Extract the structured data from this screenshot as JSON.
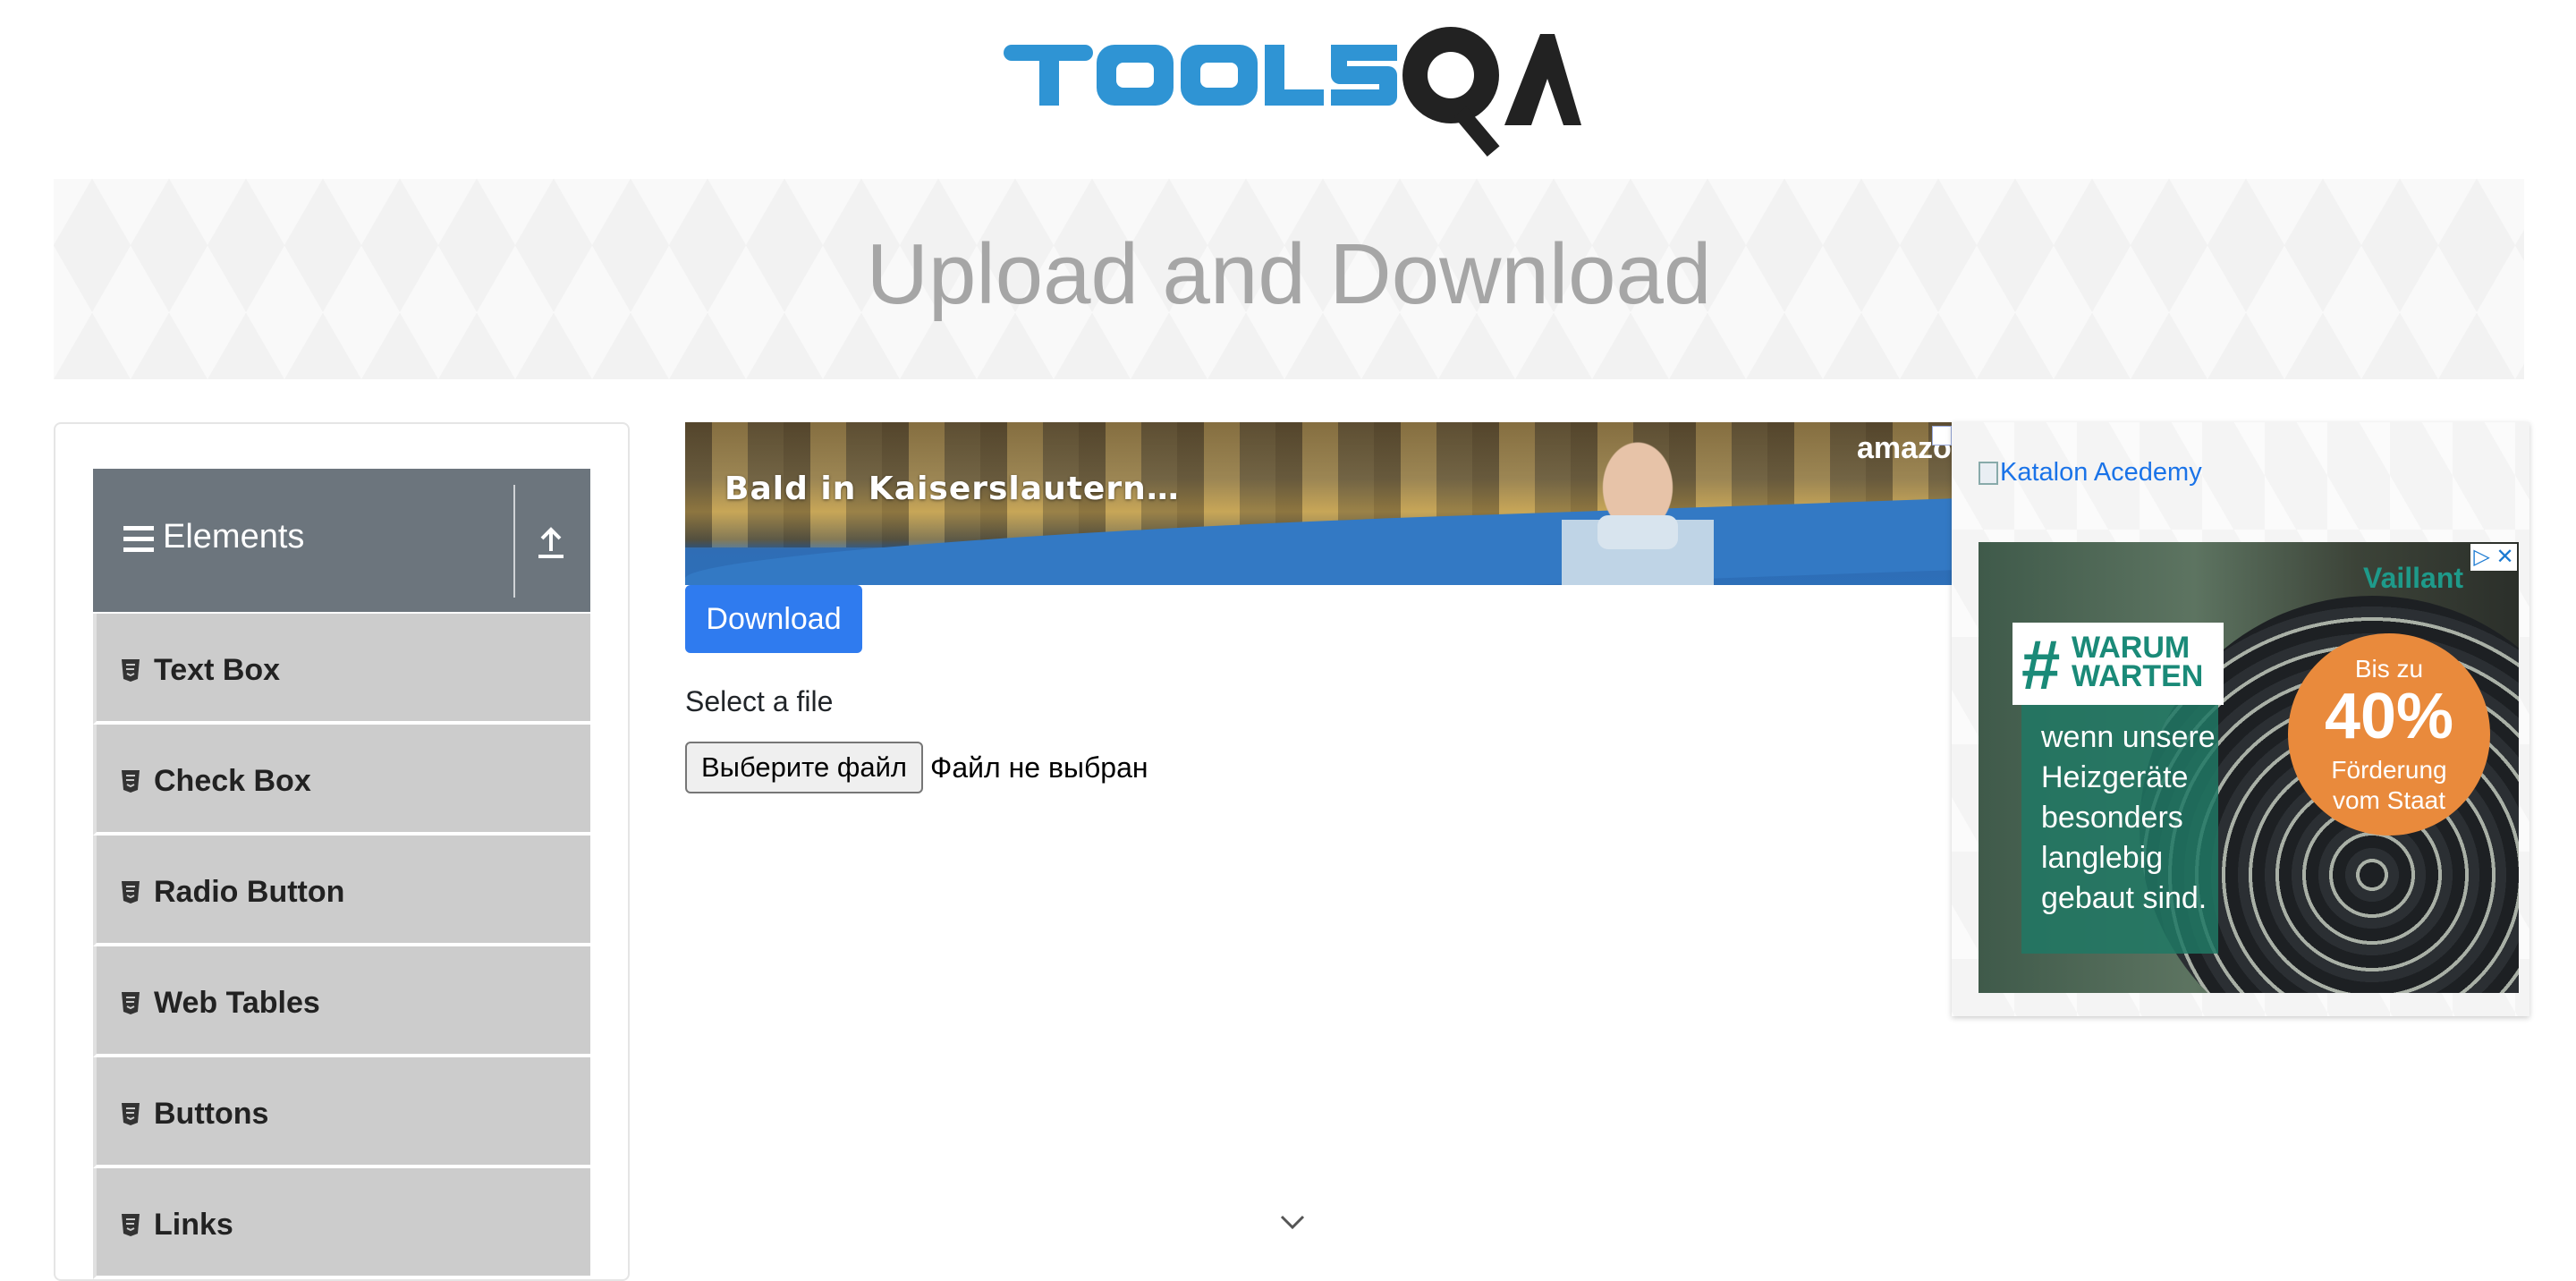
{
  "header": {
    "logo_text": "TOOLSQA"
  },
  "banner": {
    "title": "Upload and Download"
  },
  "sidebar": {
    "group_label": "Elements",
    "items": [
      {
        "label": "Text Box"
      },
      {
        "label": "Check Box"
      },
      {
        "label": "Radio Button"
      },
      {
        "label": "Web Tables"
      },
      {
        "label": "Buttons"
      },
      {
        "label": "Links"
      }
    ]
  },
  "main": {
    "ad_top": {
      "text": "Bald in Kaiserslautern…",
      "brand": "amazo"
    },
    "download_label": "Download",
    "select_label": "Select a file",
    "file_button_label": "Выберите файл",
    "file_status": "Файл не выбран"
  },
  "right_ad": {
    "katalon_alt": "Katalon Acedemy",
    "vaillant": {
      "brand": "Vaillant",
      "hash": "#",
      "headline_1": "WARUM",
      "headline_2": "WARTEN",
      "body_1": "wenn unsere",
      "body_2": "Heizgeräte",
      "body_3": "besonders",
      "body_4": "langlebig",
      "body_5": "gebaut sind.",
      "circle_1": "Bis zu",
      "circle_2": "40%",
      "circle_3": "Förderung",
      "circle_4": "vom Staat"
    }
  },
  "colors": {
    "brand_blue": "#2f94d4",
    "button_blue": "#2f7bef",
    "sidebar_header": "#6c757d",
    "sidebar_item": "#cccccc"
  }
}
